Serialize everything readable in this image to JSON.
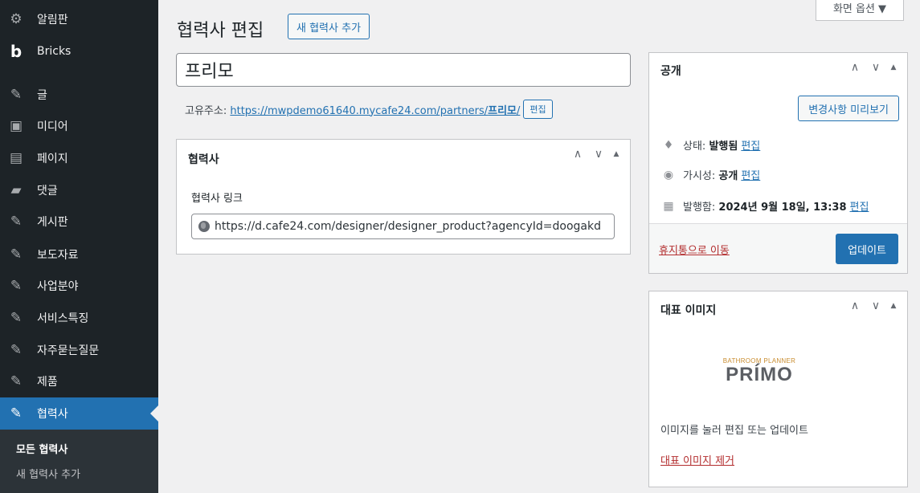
{
  "sidebar": {
    "items": [
      {
        "label": "알림판",
        "icon": "dashboard-icon",
        "glyph": "⚙"
      },
      {
        "label": "Bricks",
        "icon": "bricks-logo-icon",
        "glyph": "b"
      },
      {
        "label": "글",
        "icon": "pin-icon",
        "glyph": "✎"
      },
      {
        "label": "미디어",
        "icon": "media-icon",
        "glyph": "▣"
      },
      {
        "label": "페이지",
        "icon": "page-icon",
        "glyph": "▤"
      },
      {
        "label": "댓글",
        "icon": "comment-icon",
        "glyph": "▰"
      },
      {
        "label": "게시판",
        "icon": "pin-icon",
        "glyph": "✎"
      },
      {
        "label": "보도자료",
        "icon": "pin-icon",
        "glyph": "✎"
      },
      {
        "label": "사업분야",
        "icon": "pin-icon",
        "glyph": "✎"
      },
      {
        "label": "서비스특징",
        "icon": "pin-icon",
        "glyph": "✎"
      },
      {
        "label": "자주묻는질문",
        "icon": "pin-icon",
        "glyph": "✎"
      },
      {
        "label": "제품",
        "icon": "pin-icon",
        "glyph": "✎"
      },
      {
        "label": "협력사",
        "icon": "pin-icon",
        "glyph": "✎"
      }
    ],
    "submenu": [
      {
        "label": "모든 협력사"
      },
      {
        "label": "새 협력사 추가"
      }
    ]
  },
  "header": {
    "title": "협력사 편집",
    "add_new": "새 협력사 추가",
    "screen_options": "화면 옵션 ▼"
  },
  "post": {
    "title": "프리모",
    "permalink_label": "고유주소:",
    "permalink_base": "https://mwpdemo61640.mycafe24.com/partners/",
    "permalink_slug": "프리모",
    "permalink_trailing": "/",
    "permalink_edit": "편집"
  },
  "partner_box": {
    "title": "협력사",
    "field_label": "협력사 링크",
    "field_value": "https://d.cafe24.com/designer/designer_product?agencyId=doogakd"
  },
  "publish_box": {
    "title": "공개",
    "preview": "변경사항 미리보기",
    "status_label": "상태:",
    "status_value": "발행됨",
    "visibility_label": "가시성:",
    "visibility_value": "공개",
    "published_label": "발행함:",
    "published_value": "2024년 9월 18일, 13:38",
    "edit": "편집",
    "trash": "휴지통으로 이동",
    "update": "업데이트"
  },
  "featured_box": {
    "title": "대표 이미지",
    "thumb_top": "BATHROOM PLANNER",
    "thumb_main": "PRÍMO",
    "help": "이미지를 눌러 편집 또는 업데이트",
    "remove": "대표 이미지 제거"
  },
  "controls": {
    "up": "∧",
    "down": "∨",
    "toggle": "▲"
  }
}
